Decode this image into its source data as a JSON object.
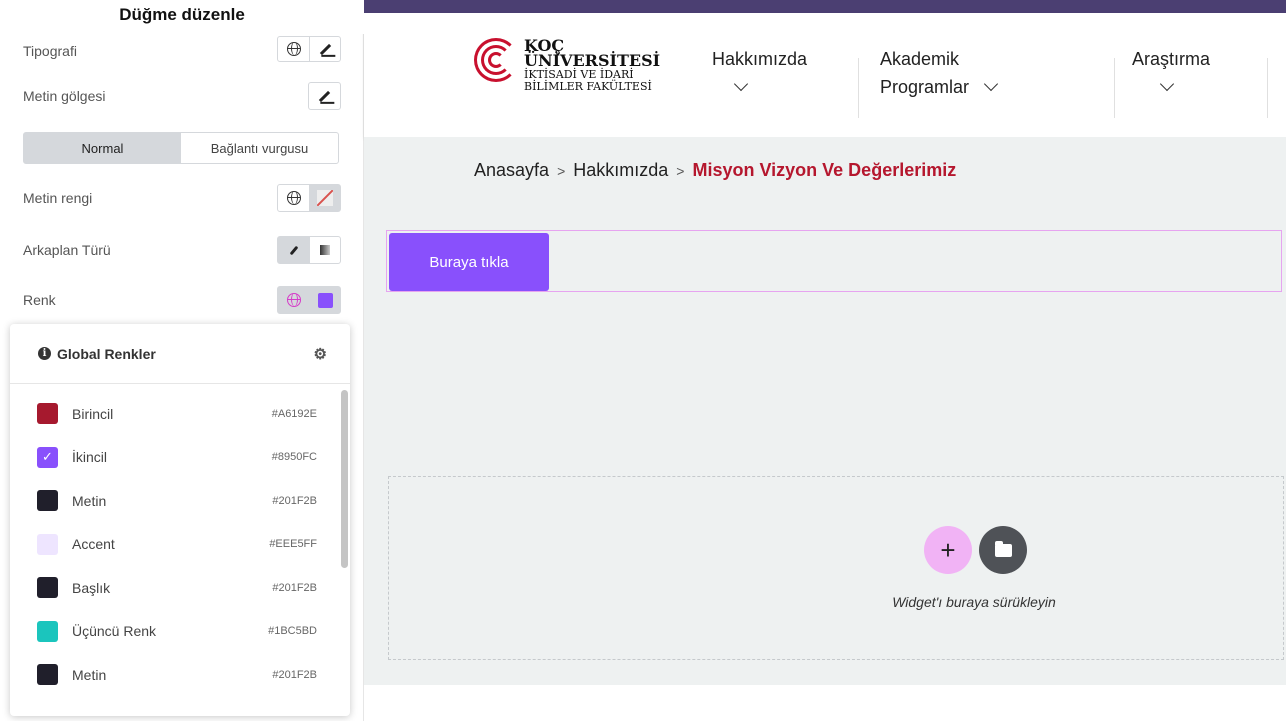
{
  "panel": {
    "title": "Düğme düzenle",
    "rows": {
      "typography": "Tipografi",
      "text_shadow": "Metin gölgesi",
      "text_color": "Metin rengi",
      "background_type": "Arkaplan Türü",
      "color": "Renk"
    },
    "tabs": [
      "Normal",
      "Bağlantı vurgusu"
    ],
    "selected_tab": "Normal",
    "selected_color_swatch": "#8950FC"
  },
  "global_colors": {
    "title": "Global Renkler",
    "items": [
      {
        "name": "Birincil",
        "hex": "#A6192E",
        "color": "#A6192E",
        "checked": false
      },
      {
        "name": "İkincil",
        "hex": "#8950FC",
        "color": "#8950FC",
        "checked": true
      },
      {
        "name": "Metin",
        "hex": "#201F2B",
        "color": "#201F2B",
        "checked": false
      },
      {
        "name": "Accent",
        "hex": "#EEE5FF",
        "color": "#EEE5FF",
        "checked": false
      },
      {
        "name": "Başlık",
        "hex": "#201F2B",
        "color": "#201F2B",
        "checked": false
      },
      {
        "name": "Üçüncü Renk",
        "hex": "#1BC5BD",
        "color": "#1BC5BD",
        "checked": false
      },
      {
        "name": "Metin",
        "hex": "#201F2B",
        "color": "#201F2B",
        "checked": false
      }
    ]
  },
  "site": {
    "logo": {
      "line1": "KOÇ",
      "line2": "ÜNİVERSİTESİ",
      "line3": "İKTİSADİ VE İDARİ",
      "line4": "BİLİMLER FAKÜLTESİ"
    },
    "nav": {
      "item1": "Hakkımızda",
      "item2_line1": "Akademik",
      "item2_line2": "Programlar",
      "item3": "Araştırma"
    },
    "breadcrumb": {
      "home": "Anasayfa",
      "parent": "Hakkımızda",
      "current": "Misyon Vizyon Ve Değerlerimiz"
    },
    "button_label": "Buraya tıkla",
    "dropzone_text": "Widget'ı buraya sürükleyin"
  },
  "colors": {
    "accent": "#8950FC",
    "brand_red": "#B5172E",
    "topbar": "#4B3F72"
  }
}
